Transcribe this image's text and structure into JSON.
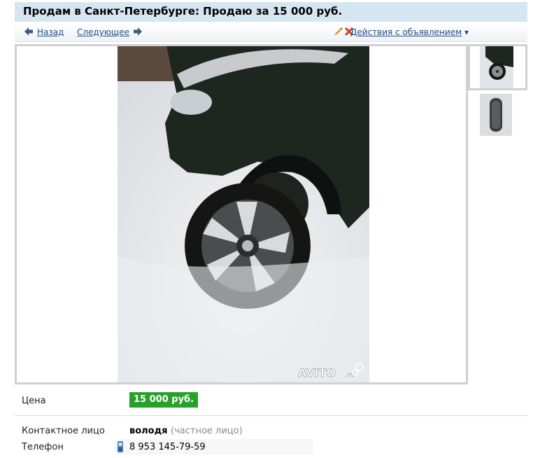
{
  "header": {
    "title": "Продам в Санкт-Петербурге: Продаю за 15 000 руб."
  },
  "nav": {
    "back_label": "Назад",
    "next_label": "Следующее",
    "actions_label": "Действия с объявлением",
    "actions_caret": "▾"
  },
  "gallery": {
    "watermark": "AVITO",
    "watermark_suffix": ".ru",
    "thumbnails": [
      "car-wheel-thumb",
      "tire-thumb"
    ]
  },
  "details": {
    "price_label": "Цена",
    "price_value": "15 000 руб.",
    "contact_label": "Контактное лицо",
    "contact_name": "володя",
    "contact_note": "(частное лицо)",
    "phone_label": "Телефон",
    "phone_value": "8 953 145-79-59"
  },
  "colors": {
    "title_bg": "#d5e6f1",
    "link": "#1c4e93",
    "price_bg": "#26a228",
    "frame_border": "#d0d0d0"
  }
}
